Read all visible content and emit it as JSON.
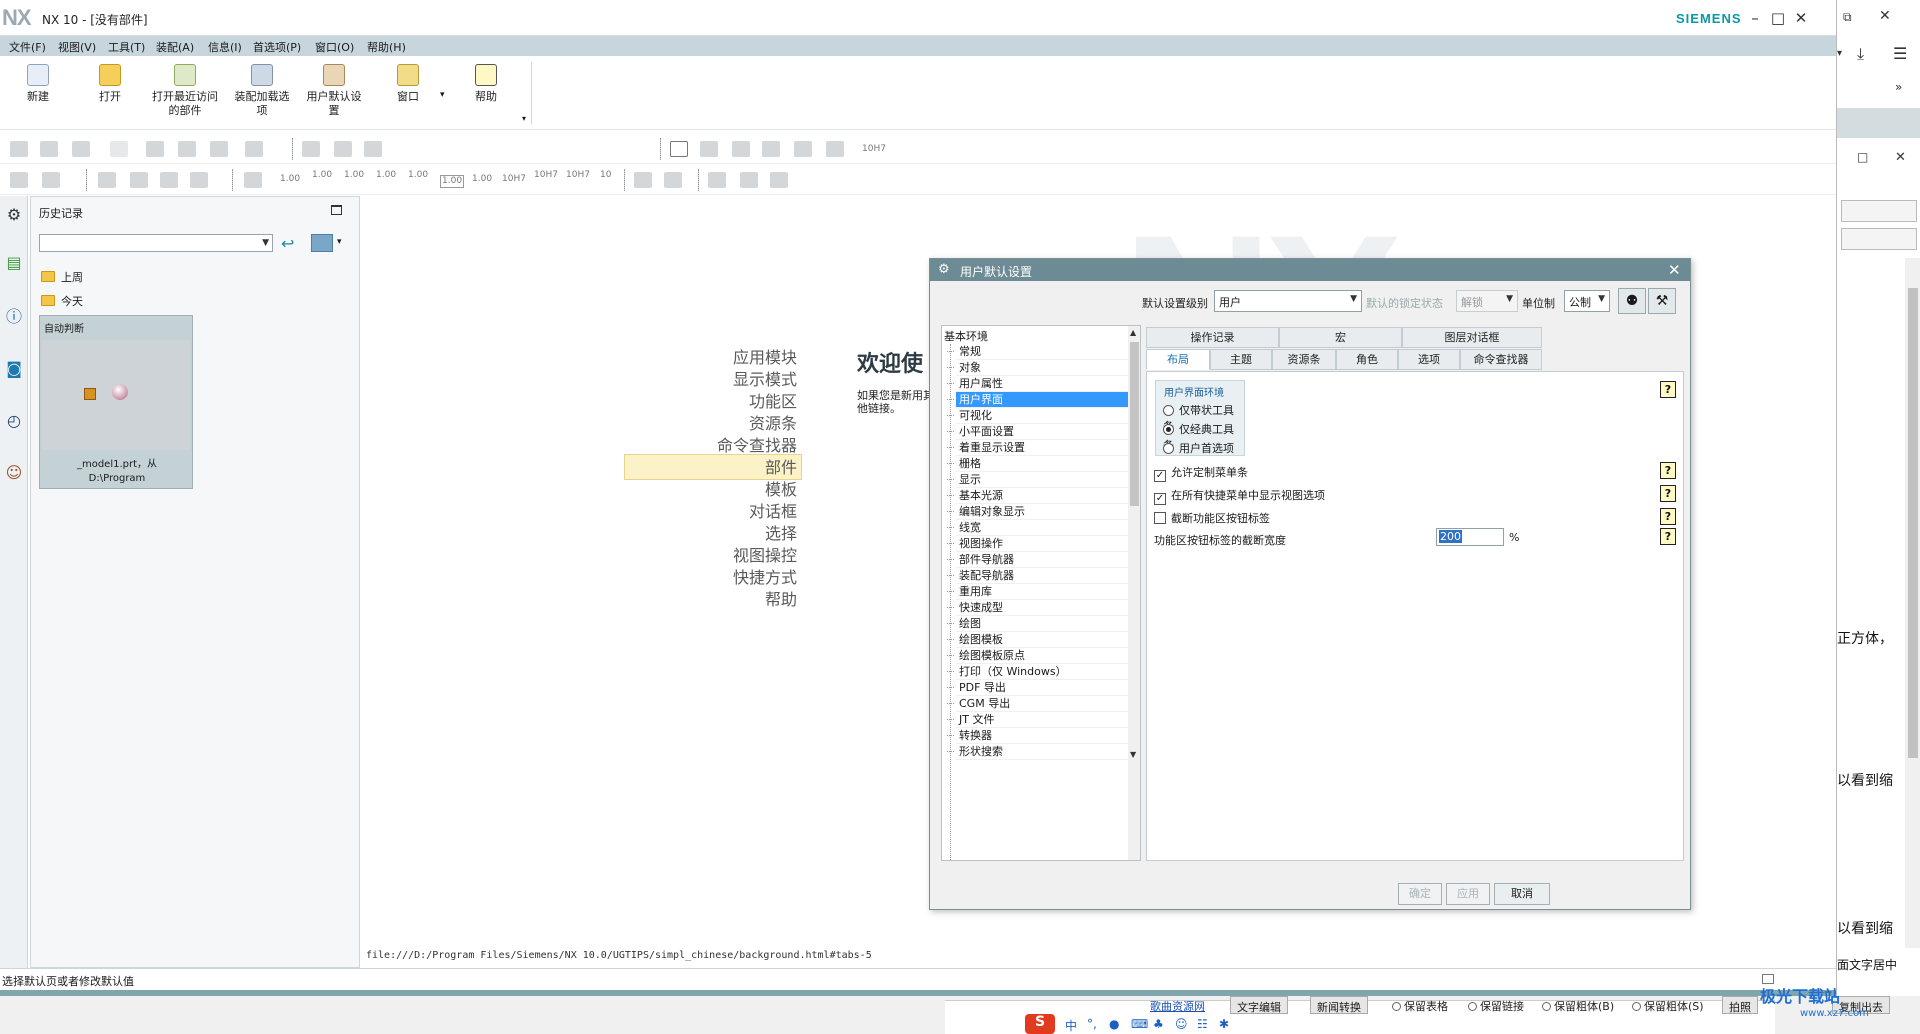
{
  "window": {
    "title": "NX 10 - [没有部件]",
    "logo": "NX",
    "brand": "SIEMENS",
    "controls": [
      "minimize",
      "maximize",
      "close"
    ]
  },
  "menubar": [
    "文件(F)",
    "视图(V)",
    "工具(T)",
    "装配(A)",
    "信息(I)",
    "首选项(P)",
    "窗口(O)",
    "帮助(H)"
  ],
  "ribbon": {
    "buttons": [
      {
        "label": "新建",
        "icon": "new-file-icon"
      },
      {
        "label": "打开",
        "icon": "open-folder-icon"
      },
      {
        "label": "打开最近访问的部件",
        "icon": "recent-parts-icon"
      },
      {
        "label": "装配加载选项",
        "icon": "assembly-load-icon"
      },
      {
        "label": "用户默认设置",
        "icon": "user-defaults-icon"
      },
      {
        "label": "窗口",
        "icon": "window-icon"
      },
      {
        "label": "帮助",
        "icon": "help-icon"
      }
    ]
  },
  "toolbar2": {
    "texts": [
      "1.00",
      "1.00",
      "1.00",
      "1.00",
      "1.00",
      "1.00",
      "1.00",
      "10H7",
      "10H7",
      "10H7",
      "10",
      "10H7"
    ]
  },
  "history": {
    "title": "历史记录",
    "groups": [
      "上周",
      "今天"
    ],
    "card": {
      "title": "自动判断",
      "name_line1": "_model1.prt，从",
      "name_line2": "D:\\Program"
    }
  },
  "main": {
    "nav_links": [
      "应用模块",
      "显示模式",
      "功能区",
      "资源条",
      "命令查找器",
      "部件",
      "模板",
      "对话框",
      "选择",
      "视图操控",
      "快捷方式",
      "帮助"
    ],
    "highlighted": "命令查找器",
    "welcome": "欢迎使",
    "welcome_sub": "如果您是新用其他链接。",
    "url": "file:///D:/Program Files/Siemens/NX 10.0/UGTIPS/simpl_chinese/background.html#tabs-5"
  },
  "statusbar": {
    "text": "选择默认页或者修改默认值"
  },
  "dialog": {
    "title": "用户默认设置",
    "level_label": "默认设置级别",
    "level_value": "用户",
    "lock_label": "默认的锁定状态",
    "lock_value": "解锁",
    "unit_label": "单位制",
    "unit_value": "公制",
    "tree_root": "基本环境",
    "tree_items": [
      "常规",
      "对象",
      "用户属性",
      "用户界面",
      "可视化",
      "小平面设置",
      "着重显示设置",
      "栅格",
      "显示",
      "基本光源",
      "编辑对象显示",
      "线宽",
      "视图操作",
      "部件导航器",
      "装配导航器",
      "重用库",
      "快速成型",
      "绘图",
      "绘图模板",
      "绘图模板原点",
      "打印（仅 Windows）",
      "PDF 导出",
      "CGM 导出",
      "JT 文件",
      "转换器",
      "形状搜索"
    ],
    "tree_selected": "用户界面",
    "tabs_row1": [
      "操作记录",
      "宏",
      "图层对话框"
    ],
    "tabs_row2": [
      "布局",
      "主题",
      "资源条",
      "角色",
      "选项",
      "命令查找器"
    ],
    "active_tab": "布局",
    "ui_env": {
      "title": "用户界面环境",
      "options": [
        "仅带状工具条",
        "仅经典工具条",
        "用户首选项"
      ],
      "selected_index": 1
    },
    "checks": [
      {
        "label": "允许定制菜单条",
        "checked": true
      },
      {
        "label": "在所有快捷菜单中显示视图选项",
        "checked": true
      },
      {
        "label": "截断功能区按钮标签",
        "checked": false
      }
    ],
    "truncate_width_label": "功能区按钮标签的截断宽度",
    "truncate_width_value": "200",
    "truncate_width_unit": "%",
    "help_glyph": "?",
    "buttons": {
      "ok": "确定",
      "apply": "应用",
      "cancel": "取消"
    }
  },
  "bottom": {
    "link": "歌曲资源网",
    "buttons": [
      "文字编辑",
      "新闻转换",
      "拍照",
      "复制出去"
    ],
    "options": [
      "保留表格",
      "保留链接",
      "保留粗体(B)",
      "保留粗体(S)"
    ],
    "ime_logo": "S",
    "ime_lang": "中",
    "watermark_cn": "极光下载站",
    "watermark_url": "www.xz7.com"
  },
  "right_panel": {
    "texts": [
      "正方体，",
      "以看到缩",
      "以看到缩",
      "面文字居中"
    ]
  },
  "colors": {
    "dialog_title": "#6c8b94",
    "menubar": "#c7d6dd",
    "selection": "#3399ff",
    "siemens": "#0a9aa4"
  }
}
